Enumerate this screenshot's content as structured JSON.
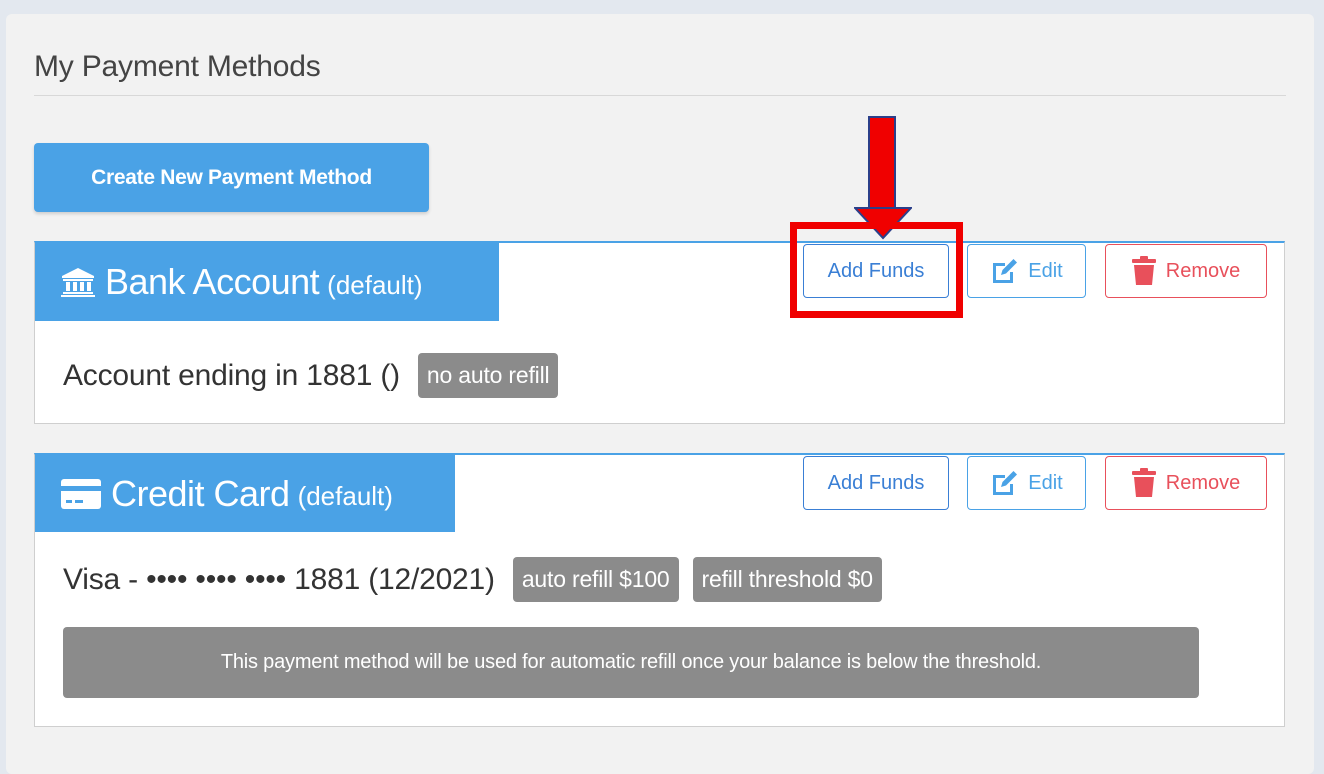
{
  "page": {
    "title": "My Payment Methods"
  },
  "toolbar": {
    "create_label": "Create New Payment Method"
  },
  "payment_methods": [
    {
      "type_icon": "bank-icon",
      "type_name": "Bank Account",
      "default_label": "(default)",
      "description": "Account ending in 1881 ()",
      "badges": [
        "no auto refill"
      ],
      "actions": {
        "add_funds": "Add Funds",
        "edit": "Edit",
        "remove": "Remove"
      }
    },
    {
      "type_icon": "credit-card-icon",
      "type_name": "Credit Card",
      "default_label": "(default)",
      "description": "Visa - •••• •••• •••• 1881 (12/2021)",
      "badges": [
        "auto refill $100",
        "refill threshold $0"
      ],
      "info": "This payment method will be used for automatic refill once your balance is below the threshold.",
      "actions": {
        "add_funds": "Add Funds",
        "edit": "Edit",
        "remove": "Remove"
      }
    }
  ],
  "colors": {
    "accent": "#4aa2e6",
    "add_funds": "#3a7fd5",
    "danger": "#e8505b",
    "badge": "#8b8b8b",
    "annotation": "#f00000"
  }
}
